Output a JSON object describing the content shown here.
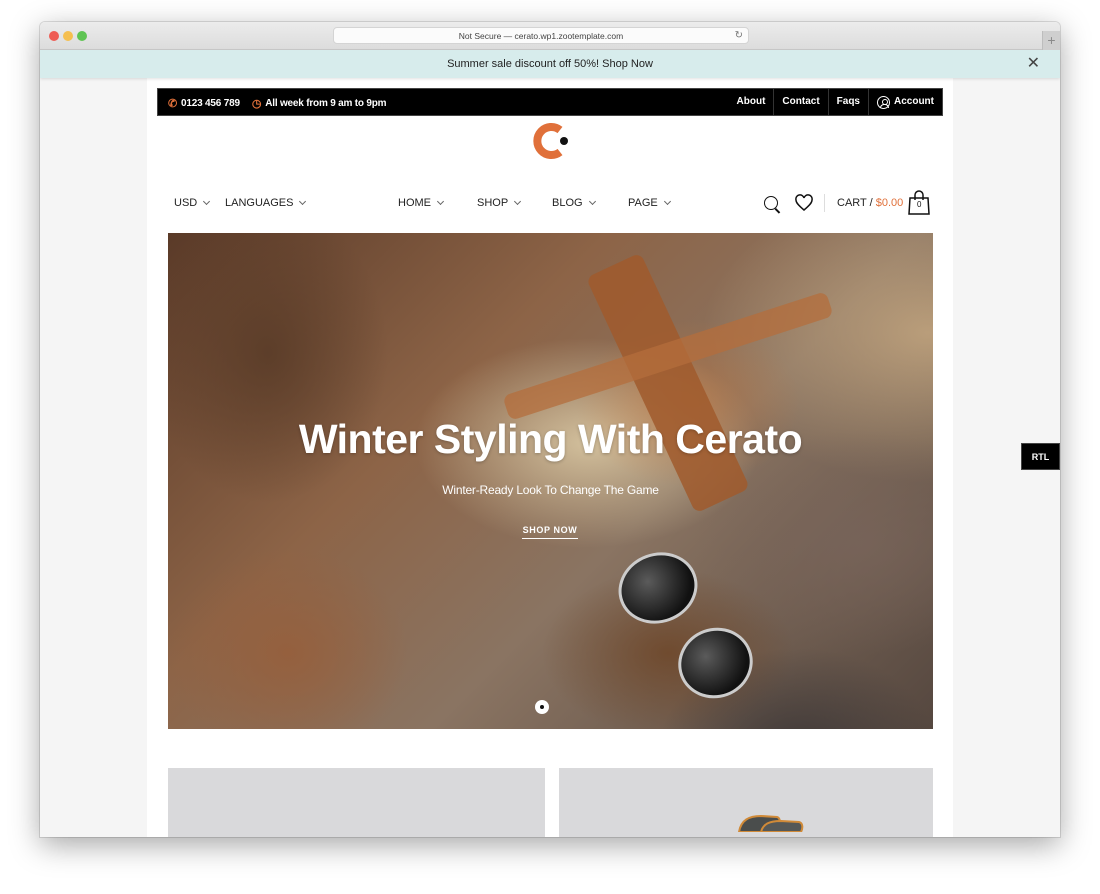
{
  "browser": {
    "url_text": "Not Secure — cerato.wp1.zootemplate.com",
    "reload_icon": "reload-icon",
    "new_tab_label": "+"
  },
  "promo": {
    "text": "Summer sale discount off 50%! Shop Now",
    "close_label": "✕"
  },
  "topbar": {
    "phone": "0123 456 789",
    "hours": "All week from 9 am to 9pm",
    "links": [
      "About",
      "Contact",
      "Faqs",
      "Account"
    ]
  },
  "brand": {
    "accent_color": "#e0703a"
  },
  "nav": {
    "currency": "USD",
    "languages": "LANGUAGES",
    "menu": [
      "HOME",
      "SHOP",
      "BLOG",
      "PAGE"
    ],
    "cart_label": "CART / ",
    "cart_total": "$0.00",
    "cart_count": "0"
  },
  "hero": {
    "title": "Winter Styling With Cerato",
    "subtitle": "Winter-Ready Look To Change The Game",
    "cta": "SHOP NOW",
    "slides_total": 1,
    "active_slide": 1
  },
  "rtl_toggle": "RTL"
}
